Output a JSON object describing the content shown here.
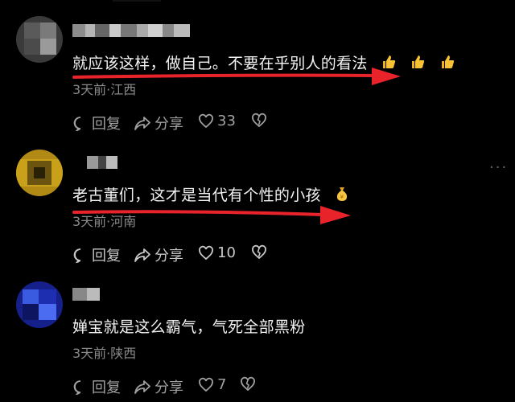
{
  "comments": [
    {
      "text": "就应该这样，做自己。不要在乎别人的看法",
      "emojis": [
        "thumbs-up",
        "thumbs-up",
        "thumbs-up"
      ],
      "meta": "3天前·江西",
      "reply_label": "回复",
      "share_label": "分享",
      "likes": "33"
    },
    {
      "text": "老古董们，这才是当代有个性的小孩",
      "emojis": [
        "money-bag"
      ],
      "meta": "3天前·河南",
      "reply_label": "回复",
      "share_label": "分享",
      "likes": "10"
    },
    {
      "text": "婵宝就是这么霸气，气死全部黑粉",
      "emojis": [],
      "meta": "3天前·陕西",
      "reply_label": "回复",
      "share_label": "分享",
      "likes": "7"
    }
  ],
  "colors": {
    "background": "#000000",
    "annotation_arrow": "#e8242a",
    "secondary_text": "#8a8a8a"
  }
}
